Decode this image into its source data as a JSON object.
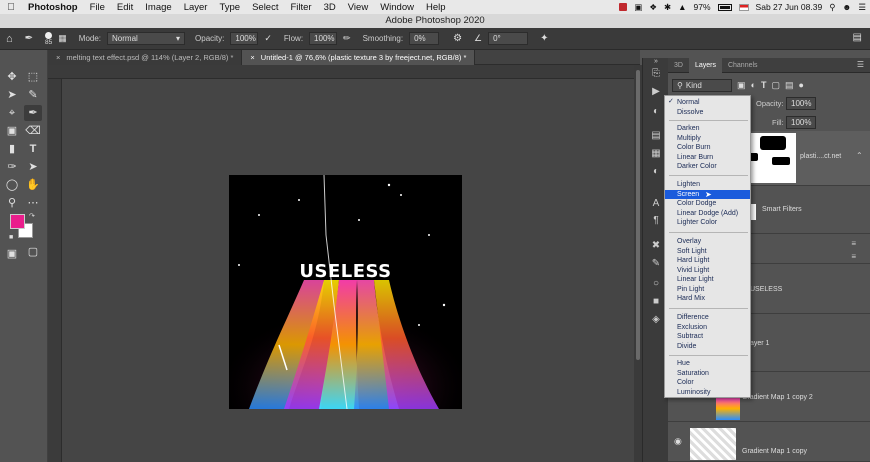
{
  "menubar": {
    "app": "Photoshop",
    "items": [
      "File",
      "Edit",
      "Image",
      "Layer",
      "Type",
      "Select",
      "Filter",
      "3D",
      "View",
      "Window",
      "Help"
    ],
    "battery": "97%",
    "datetime": "Sab 27 Jun  08.39"
  },
  "window_title": "Adobe Photoshop 2020",
  "options_bar": {
    "brush_size": "85",
    "mode_label": "Mode:",
    "mode_value": "Normal",
    "opacity_label": "Opacity:",
    "opacity_value": "100%",
    "flow_label": "Flow:",
    "flow_value": "100%",
    "smoothing_label": "Smoothing:",
    "smoothing_value": "0%",
    "angle_value": "0°"
  },
  "tabs": [
    {
      "label": "melting text effect.psd @ 114% (Layer 2, RGB/8) *",
      "active": false
    },
    {
      "label": "Untitled-1 @ 76,6% (plastic texture 3 by freeject.net, RGB/8) *",
      "active": true
    }
  ],
  "canvas": {
    "text": "USELESS"
  },
  "panels": {
    "tabs": [
      "3D",
      "Layers",
      "Channels"
    ],
    "kind_label": "Kind",
    "opacity_label": "Opacity:",
    "opacity_value": "100%",
    "fill_label": "Fill:",
    "fill_value": "100%"
  },
  "layers": [
    {
      "name": "plasti....ct.net"
    },
    {
      "name": "Smart Filters"
    },
    {
      "name": "USELESS"
    },
    {
      "name": "ayer 1"
    },
    {
      "name": "Gradient Map 1 copy 2"
    },
    {
      "name": "Gradient Map 1 copy"
    }
  ],
  "blend_menu": {
    "selected": "Normal",
    "highlighted": "Screen",
    "groups": [
      [
        "Normal",
        "Dissolve"
      ],
      [
        "Darken",
        "Multiply",
        "Color Burn",
        "Linear Burn",
        "Darker Color"
      ],
      [
        "Lighten",
        "Screen",
        "Color Dodge",
        "Linear Dodge (Add)",
        "Lighter Color"
      ],
      [
        "Overlay",
        "Soft Light",
        "Hard Light",
        "Vivid Light",
        "Linear Light",
        "Pin Light",
        "Hard Mix"
      ],
      [
        "Difference",
        "Exclusion",
        "Subtract",
        "Divide"
      ],
      [
        "Hue",
        "Saturation",
        "Color",
        "Luminosity"
      ]
    ]
  },
  "colors": {
    "foreground": "#ea1e8c",
    "background": "#ffffff",
    "highlight": "#1a5bdc"
  }
}
